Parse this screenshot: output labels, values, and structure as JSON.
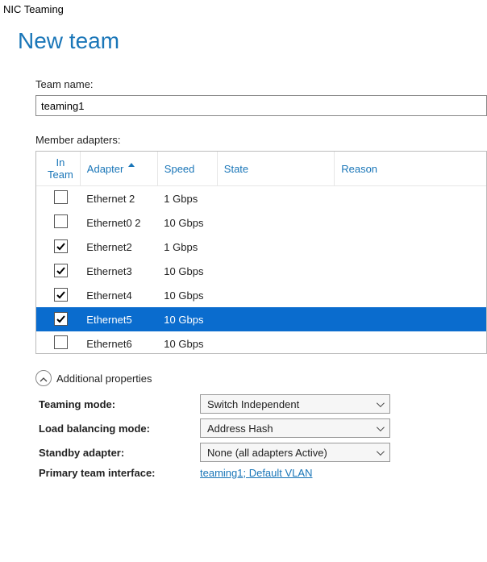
{
  "window_title": "NIC Teaming",
  "heading": "New team",
  "team_name_label": "Team name:",
  "team_name_value": "teaming1",
  "member_adapters_label": "Member adapters:",
  "columns": {
    "in_team": "In Team",
    "adapter": "Adapter",
    "speed": "Speed",
    "state": "State",
    "reason": "Reason"
  },
  "sort_column": "adapter",
  "adapters": [
    {
      "checked": false,
      "name": "Ethernet 2",
      "speed": "1 Gbps",
      "selected": false
    },
    {
      "checked": false,
      "name": "Ethernet0 2",
      "speed": "10 Gbps",
      "selected": false
    },
    {
      "checked": true,
      "name": "Ethernet2",
      "speed": "1 Gbps",
      "selected": false
    },
    {
      "checked": true,
      "name": "Ethernet3",
      "speed": "10 Gbps",
      "selected": false
    },
    {
      "checked": true,
      "name": "Ethernet4",
      "speed": "10 Gbps",
      "selected": false
    },
    {
      "checked": true,
      "name": "Ethernet5",
      "speed": "10 Gbps",
      "selected": true
    },
    {
      "checked": false,
      "name": "Ethernet6",
      "speed": "10 Gbps",
      "selected": false
    }
  ],
  "additional": {
    "header": "Additional properties",
    "expanded": true,
    "teaming_mode_label": "Teaming mode:",
    "teaming_mode_value": "Switch Independent",
    "load_balancing_label": "Load balancing mode:",
    "load_balancing_value": "Address Hash",
    "standby_label": "Standby adapter:",
    "standby_value": "None (all adapters Active)",
    "primary_if_label": "Primary team interface:",
    "primary_if_value": "teaming1; Default VLAN"
  }
}
